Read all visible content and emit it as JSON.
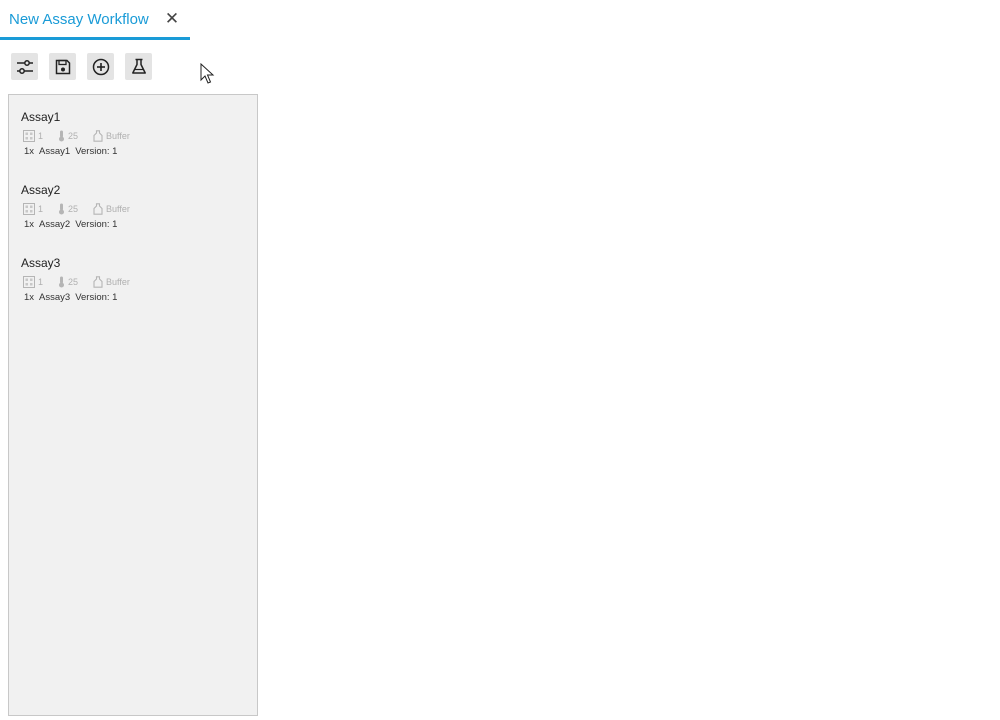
{
  "tab": {
    "title": "New Assay Workflow",
    "close_icon": "close-icon",
    "accent_color": "#1a9bd7"
  },
  "toolbar": {
    "buttons": [
      {
        "icon": "sliders-icon"
      },
      {
        "icon": "save-icon"
      },
      {
        "icon": "add-circle-icon"
      },
      {
        "icon": "flask-icon"
      }
    ]
  },
  "assays": [
    {
      "name": "Assay1",
      "plate_count": "1",
      "temperature": "25",
      "buffer": "Buffer",
      "multiplier": "1x",
      "ref_name": "Assay1",
      "version": "Version: 1"
    },
    {
      "name": "Assay2",
      "plate_count": "1",
      "temperature": "25",
      "buffer": "Buffer",
      "multiplier": "1x",
      "ref_name": "Assay2",
      "version": "Version: 1"
    },
    {
      "name": "Assay3",
      "plate_count": "1",
      "temperature": "25",
      "buffer": "Buffer",
      "multiplier": "1x",
      "ref_name": "Assay3",
      "version": "Version: 1"
    }
  ]
}
